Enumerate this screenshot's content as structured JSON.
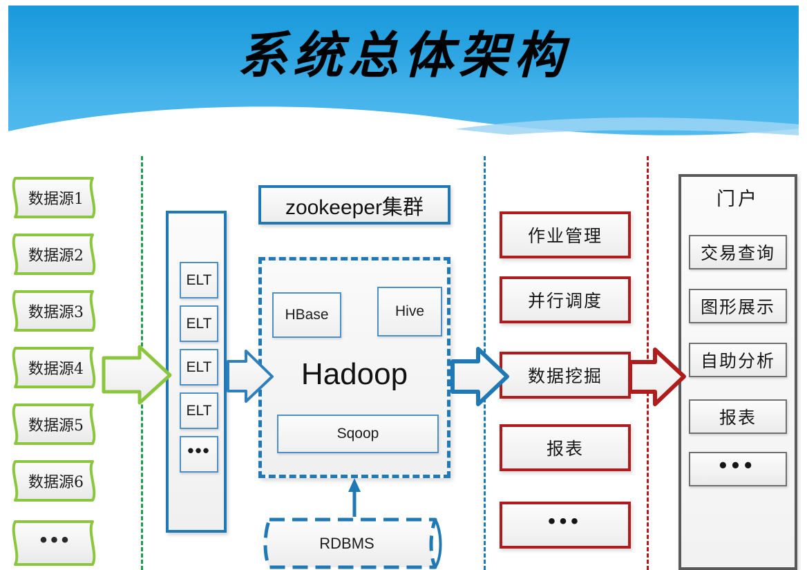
{
  "header": {
    "title": "系统总体架构",
    "sky_color": "#2ba4e2",
    "wave_color": "#ffffff"
  },
  "dividers": [
    {
      "name": "green-divider",
      "color": "#1f9a4d"
    },
    {
      "name": "blue-divider",
      "color": "#2079b5"
    },
    {
      "name": "red-divider",
      "color": "#b01b1b"
    }
  ],
  "data_sources": {
    "border_color": "#8cc63f",
    "items": [
      {
        "label": "数据源1"
      },
      {
        "label": "数据源2"
      },
      {
        "label": "数据源3"
      },
      {
        "label": "数据源4"
      },
      {
        "label": "数据源5"
      },
      {
        "label": "数据源6"
      },
      {
        "label": "•••"
      }
    ]
  },
  "elt_column": {
    "border_color": "#2079b5",
    "items": [
      {
        "label": "ELT"
      },
      {
        "label": "ELT"
      },
      {
        "label": "ELT"
      },
      {
        "label": "ELT"
      },
      {
        "label": "•••"
      }
    ]
  },
  "platform": {
    "zookeeper": "zookeeper集群",
    "hadoop": "Hadoop",
    "hbase": "HBase",
    "hive": "Hive",
    "sqoop": "Sqoop",
    "rdbms": "RDBMS",
    "border_color": "#2079b5"
  },
  "services": {
    "border_color": "#b01b1b",
    "items": [
      {
        "label": "作业管理"
      },
      {
        "label": "并行调度"
      },
      {
        "label": "数据挖掘"
      },
      {
        "label": "报表"
      },
      {
        "label": "•••"
      }
    ]
  },
  "portal": {
    "title": "门户",
    "border_color": "#5a5a5a",
    "items": [
      {
        "label": "交易查询"
      },
      {
        "label": "图形展示"
      },
      {
        "label": "自助分析"
      },
      {
        "label": "报表"
      },
      {
        "label": "•••"
      }
    ]
  },
  "arrows": [
    {
      "name": "green-arrow-sources-to-elt",
      "color": "#8cc63f"
    },
    {
      "name": "blue-arrow-elt-to-hadoop",
      "color": "#2079b5"
    },
    {
      "name": "blue-arrow-hadoop-to-services",
      "color": "#2079b5"
    },
    {
      "name": "red-arrow-services-to-portal",
      "color": "#b01b1b"
    },
    {
      "name": "blue-arrow-rdbms-to-hadoop",
      "color": "#2079b5"
    }
  ]
}
